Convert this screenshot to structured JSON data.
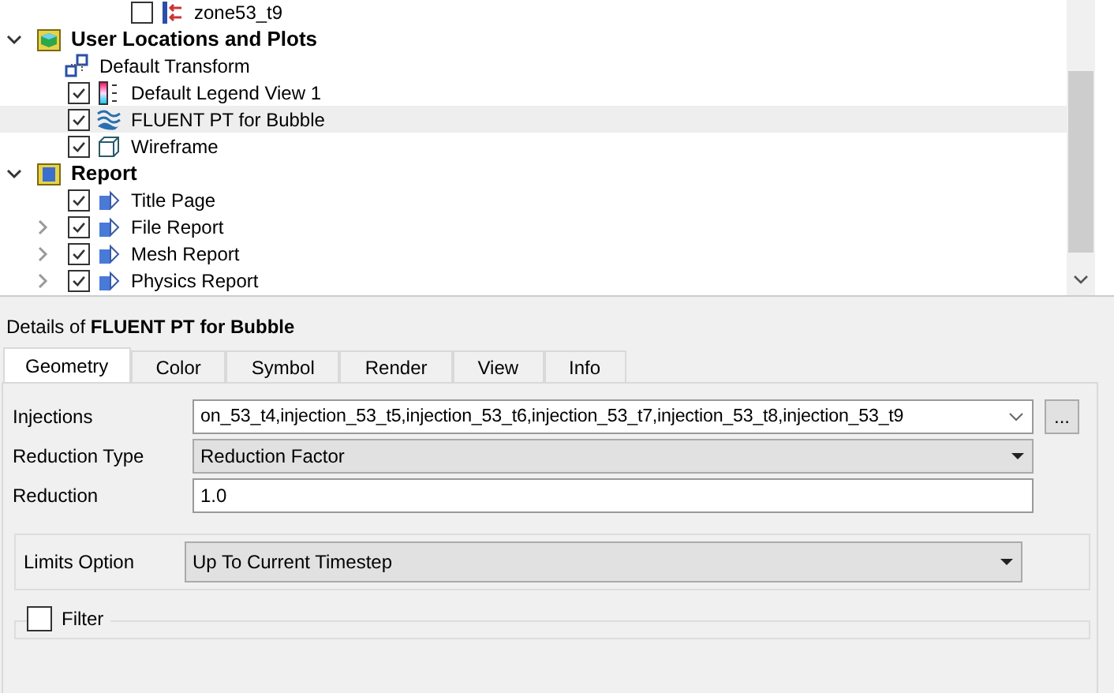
{
  "tree_top_item": {
    "label": "zone53_t9",
    "kind": "zone",
    "checked": false
  },
  "tree": [
    {
      "label": "User Locations and Plots",
      "kind": "user-folder",
      "expanded": true,
      "selected": false,
      "children": [
        {
          "label": "Default Transform",
          "kind": "transform",
          "selected": false
        },
        {
          "label": "Default Legend View 1",
          "kind": "legend",
          "checked": true,
          "selected": false
        },
        {
          "label": "FLUENT PT for Bubble",
          "kind": "tracks",
          "checked": true,
          "selected": true
        },
        {
          "label": "Wireframe",
          "kind": "wireframe",
          "checked": true,
          "selected": false
        }
      ]
    },
    {
      "label": "Report",
      "kind": "report-folder",
      "expanded": true,
      "selected": false,
      "children": [
        {
          "label": "Title Page",
          "kind": "report-page",
          "checked": true,
          "selected": false
        },
        {
          "label": "File Report",
          "kind": "report-page",
          "checked": true,
          "expanded": false,
          "selected": false
        },
        {
          "label": "Mesh Report",
          "kind": "report-page",
          "checked": true,
          "expanded": false,
          "selected": false
        },
        {
          "label": "Physics Report",
          "kind": "report-page",
          "checked": true,
          "expanded": false,
          "selected": false
        }
      ]
    }
  ],
  "details": {
    "title": "Details of **FLUENT PT for Bubble**",
    "tabs": [
      {
        "label": "Geometry",
        "selected": true
      },
      {
        "label": "Color",
        "selected": false
      },
      {
        "label": "Symbol",
        "selected": false
      },
      {
        "label": "Render",
        "selected": false
      },
      {
        "label": "View",
        "selected": false
      },
      {
        "label": "Info",
        "selected": false
      }
    ],
    "fields": [
      {
        "label": "Injections",
        "kind": "combo",
        "value": "on_53_t4,injection_53_t5,injection_53_t6,injection_53_t7,injection_53_t8,injection_53_t9",
        "button": "..."
      },
      {
        "label": "Reduction Type",
        "kind": "select",
        "value": "Reduction Factor"
      },
      {
        "label": "Reduction",
        "kind": "input",
        "value": "1.0"
      }
    ],
    "limits": {
      "label": "Limits Option",
      "value": "Up To Current Timestep"
    },
    "filter": {
      "label": "Filter",
      "checked": false
    }
  }
}
